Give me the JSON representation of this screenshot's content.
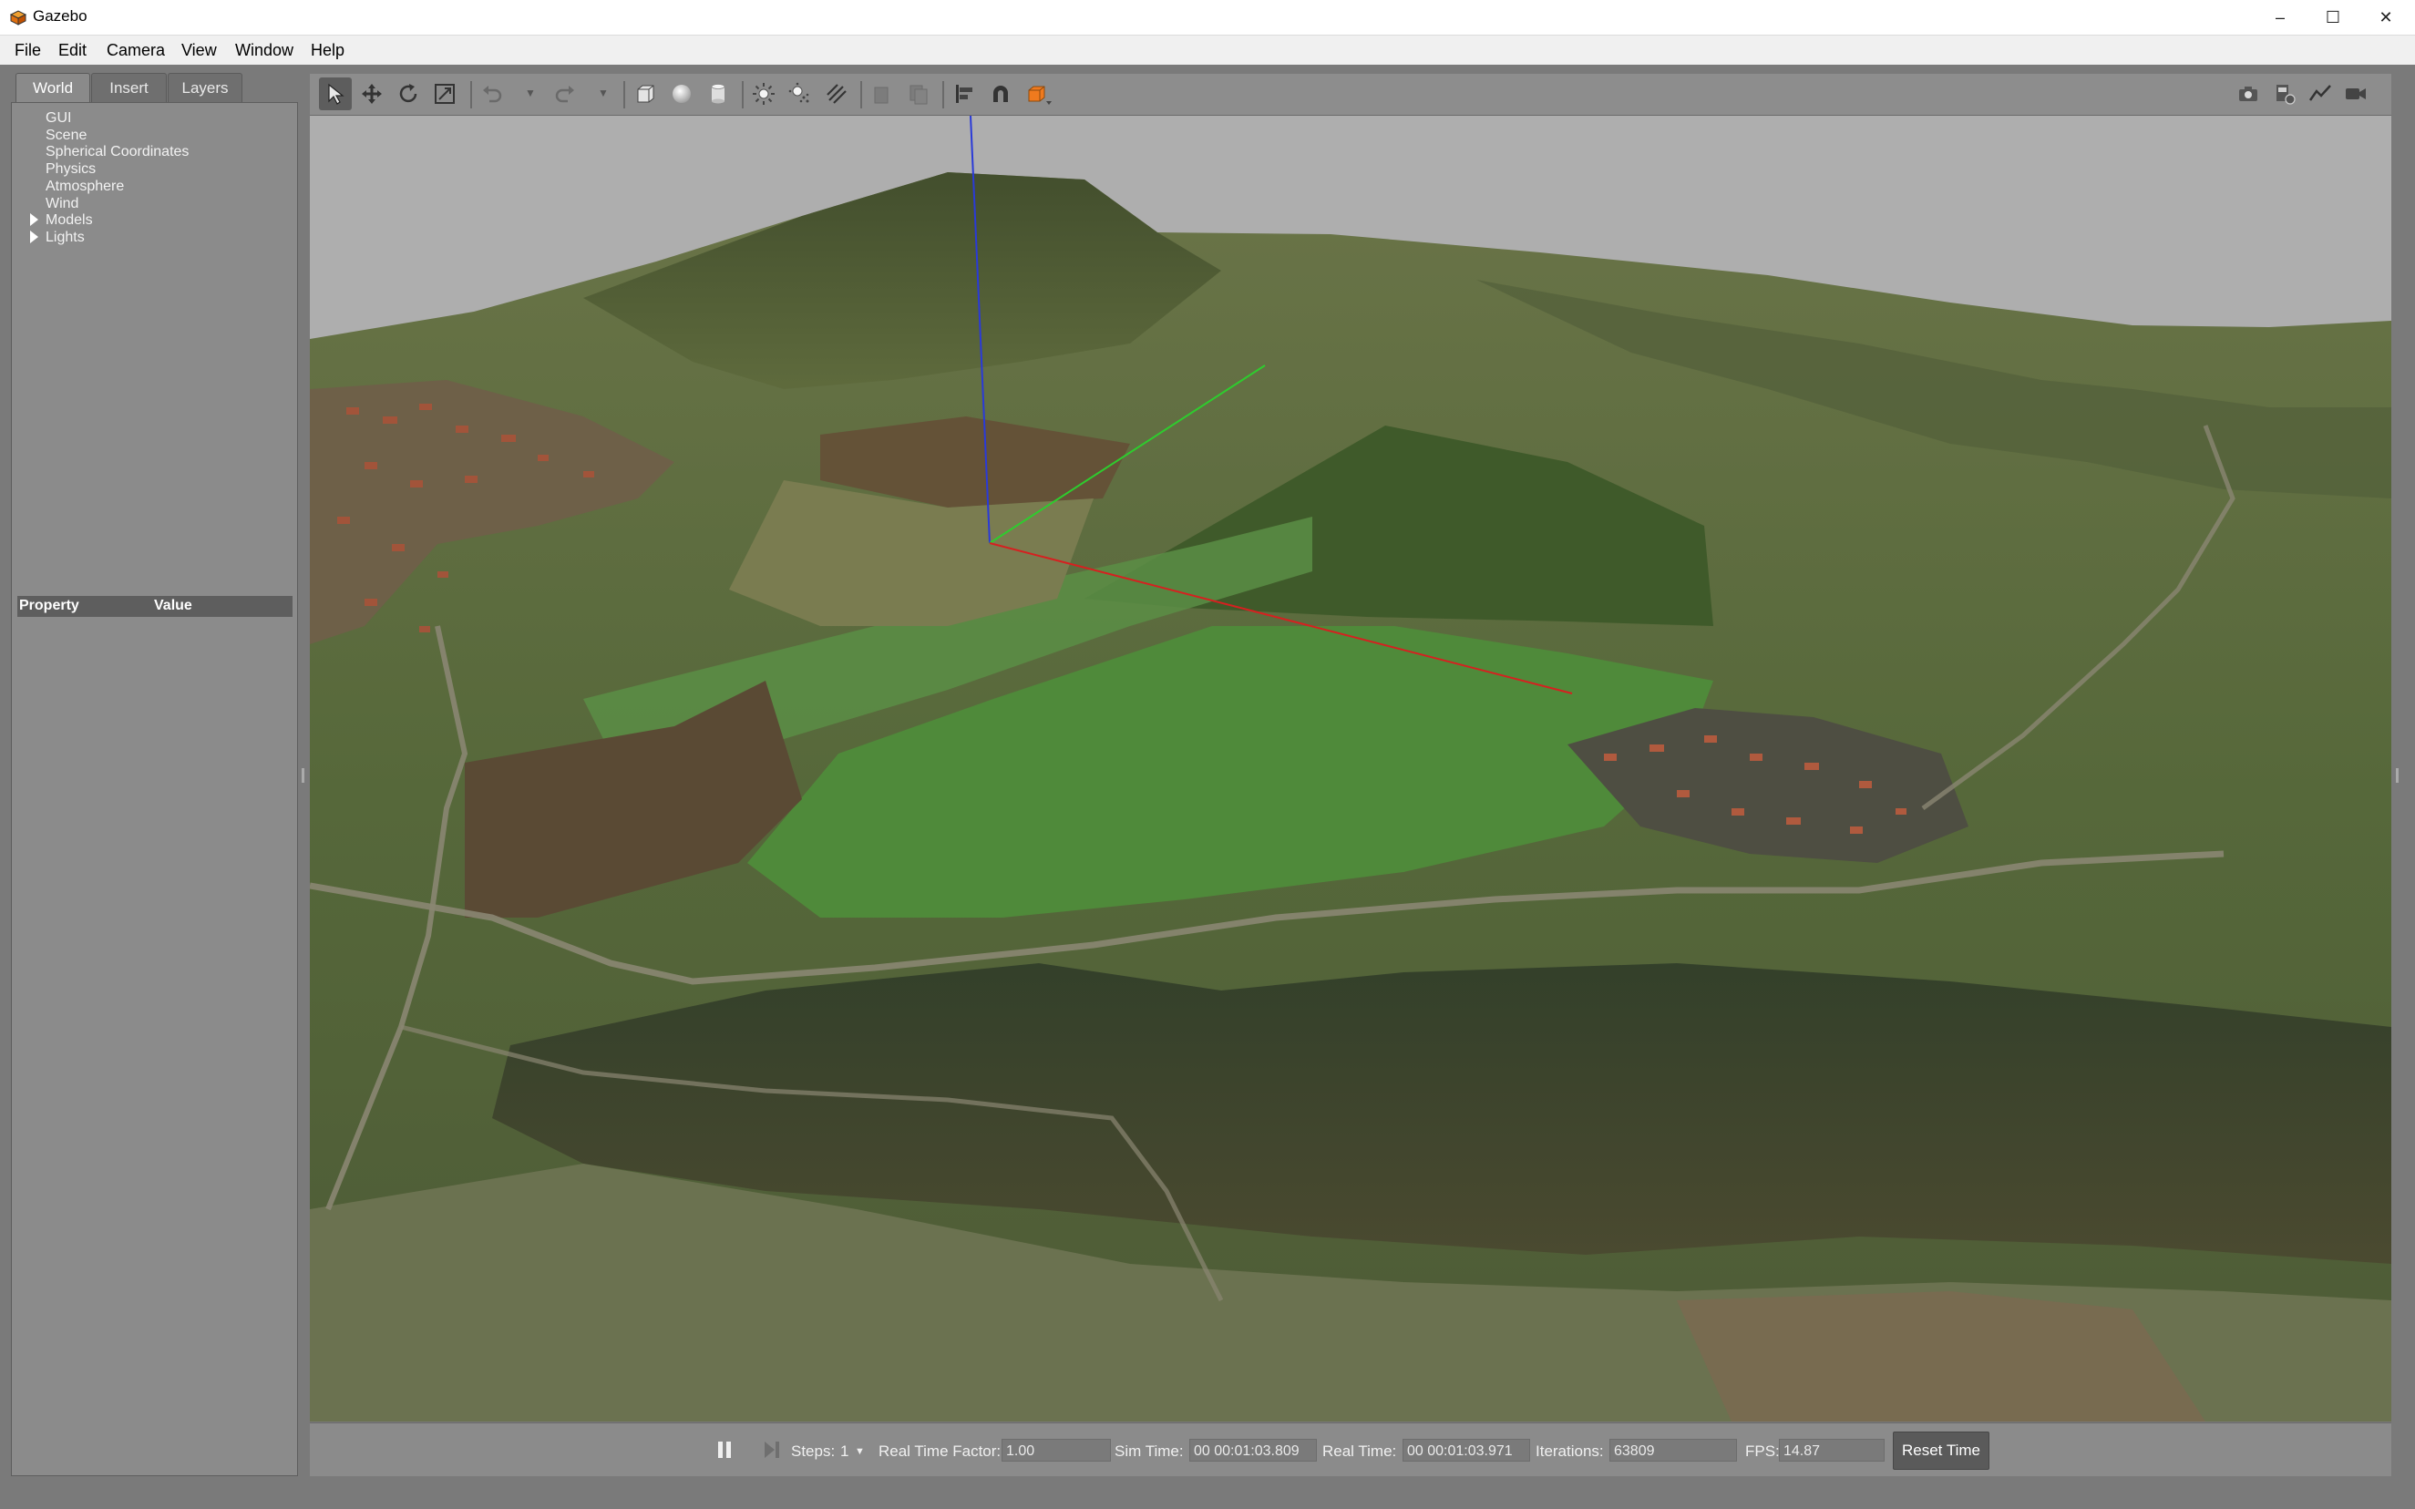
{
  "window": {
    "title": "Gazebo",
    "minimize": "–",
    "maximize": "☐",
    "close": "✕"
  },
  "menu": [
    "File",
    "Edit",
    "Camera",
    "View",
    "Window",
    "Help"
  ],
  "left_panel": {
    "tabs": [
      "World",
      "Insert",
      "Layers"
    ],
    "active_tab": "World",
    "tree": [
      {
        "label": "GUI",
        "expandable": false
      },
      {
        "label": "Scene",
        "expandable": false
      },
      {
        "label": "Spherical Coordinates",
        "expandable": false
      },
      {
        "label": "Physics",
        "expandable": false
      },
      {
        "label": "Atmosphere",
        "expandable": false
      },
      {
        "label": "Wind",
        "expandable": false
      },
      {
        "label": "Models",
        "expandable": true
      },
      {
        "label": "Lights",
        "expandable": true
      }
    ],
    "property_header": {
      "property": "Property",
      "value": "Value"
    }
  },
  "toolbar": {
    "left_icons": [
      "select-arrow-icon",
      "translate-icon",
      "rotate-icon",
      "scale-icon",
      "undo-icon",
      "redo-icon",
      "box-icon",
      "sphere-icon",
      "cylinder-icon",
      "point-light-icon",
      "spot-light-icon",
      "directional-light-icon",
      "copy-icon",
      "paste-icon",
      "align-icon",
      "snap-icon",
      "view-angle-icon"
    ],
    "right_icons": [
      "screenshot-icon",
      "log-icon",
      "plot-icon",
      "video-icon"
    ],
    "active_tool": "select-arrow-icon",
    "accent_color": "#f07a1e"
  },
  "viewport": {
    "axis_colors": {
      "x": "#d62020",
      "y": "#2ecc2e",
      "z": "#2a3ad8"
    },
    "sky_color": "#aeaeae"
  },
  "bottom_bar": {
    "steps_label": "Steps:",
    "steps_value": "1",
    "rtf_label": "Real Time Factor:",
    "rtf_value": "1.00",
    "sim_time_label": "Sim Time:",
    "sim_time_value": "00 00:01:03.809",
    "real_time_label": "Real Time:",
    "real_time_value": "00 00:01:03.971",
    "iterations_label": "Iterations:",
    "iterations_value": "63809",
    "fps_label": "FPS:",
    "fps_value": "14.87",
    "reset_label": "Reset Time"
  }
}
